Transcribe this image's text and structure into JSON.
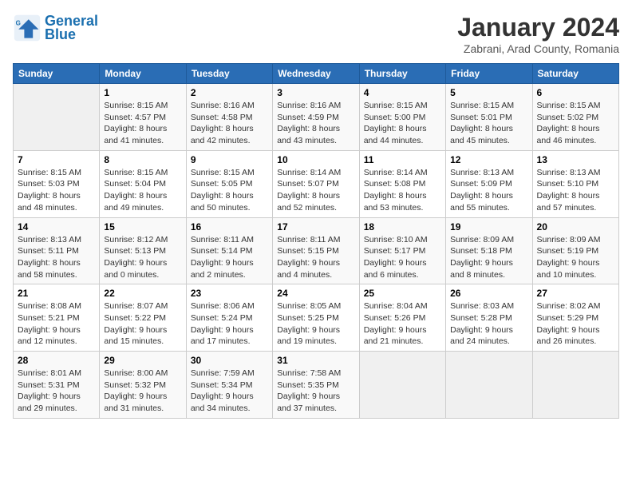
{
  "header": {
    "logo_line1": "General",
    "logo_line2": "Blue",
    "title": "January 2024",
    "subtitle": "Zabrani, Arad County, Romania"
  },
  "columns": [
    "Sunday",
    "Monday",
    "Tuesday",
    "Wednesday",
    "Thursday",
    "Friday",
    "Saturday"
  ],
  "weeks": [
    [
      {
        "day": "",
        "empty": true
      },
      {
        "day": "1",
        "sunrise": "8:15 AM",
        "sunset": "4:57 PM",
        "daylight": "8 hours and 41 minutes."
      },
      {
        "day": "2",
        "sunrise": "8:16 AM",
        "sunset": "4:58 PM",
        "daylight": "8 hours and 42 minutes."
      },
      {
        "day": "3",
        "sunrise": "8:16 AM",
        "sunset": "4:59 PM",
        "daylight": "8 hours and 43 minutes."
      },
      {
        "day": "4",
        "sunrise": "8:15 AM",
        "sunset": "5:00 PM",
        "daylight": "8 hours and 44 minutes."
      },
      {
        "day": "5",
        "sunrise": "8:15 AM",
        "sunset": "5:01 PM",
        "daylight": "8 hours and 45 minutes."
      },
      {
        "day": "6",
        "sunrise": "8:15 AM",
        "sunset": "5:02 PM",
        "daylight": "8 hours and 46 minutes."
      }
    ],
    [
      {
        "day": "7",
        "sunrise": "8:15 AM",
        "sunset": "5:03 PM",
        "daylight": "8 hours and 48 minutes."
      },
      {
        "day": "8",
        "sunrise": "8:15 AM",
        "sunset": "5:04 PM",
        "daylight": "8 hours and 49 minutes."
      },
      {
        "day": "9",
        "sunrise": "8:15 AM",
        "sunset": "5:05 PM",
        "daylight": "8 hours and 50 minutes."
      },
      {
        "day": "10",
        "sunrise": "8:14 AM",
        "sunset": "5:07 PM",
        "daylight": "8 hours and 52 minutes."
      },
      {
        "day": "11",
        "sunrise": "8:14 AM",
        "sunset": "5:08 PM",
        "daylight": "8 hours and 53 minutes."
      },
      {
        "day": "12",
        "sunrise": "8:13 AM",
        "sunset": "5:09 PM",
        "daylight": "8 hours and 55 minutes."
      },
      {
        "day": "13",
        "sunrise": "8:13 AM",
        "sunset": "5:10 PM",
        "daylight": "8 hours and 57 minutes."
      }
    ],
    [
      {
        "day": "14",
        "sunrise": "8:13 AM",
        "sunset": "5:11 PM",
        "daylight": "8 hours and 58 minutes."
      },
      {
        "day": "15",
        "sunrise": "8:12 AM",
        "sunset": "5:13 PM",
        "daylight": "9 hours and 0 minutes."
      },
      {
        "day": "16",
        "sunrise": "8:11 AM",
        "sunset": "5:14 PM",
        "daylight": "9 hours and 2 minutes."
      },
      {
        "day": "17",
        "sunrise": "8:11 AM",
        "sunset": "5:15 PM",
        "daylight": "9 hours and 4 minutes."
      },
      {
        "day": "18",
        "sunrise": "8:10 AM",
        "sunset": "5:17 PM",
        "daylight": "9 hours and 6 minutes."
      },
      {
        "day": "19",
        "sunrise": "8:09 AM",
        "sunset": "5:18 PM",
        "daylight": "9 hours and 8 minutes."
      },
      {
        "day": "20",
        "sunrise": "8:09 AM",
        "sunset": "5:19 PM",
        "daylight": "9 hours and 10 minutes."
      }
    ],
    [
      {
        "day": "21",
        "sunrise": "8:08 AM",
        "sunset": "5:21 PM",
        "daylight": "9 hours and 12 minutes."
      },
      {
        "day": "22",
        "sunrise": "8:07 AM",
        "sunset": "5:22 PM",
        "daylight": "9 hours and 15 minutes."
      },
      {
        "day": "23",
        "sunrise": "8:06 AM",
        "sunset": "5:24 PM",
        "daylight": "9 hours and 17 minutes."
      },
      {
        "day": "24",
        "sunrise": "8:05 AM",
        "sunset": "5:25 PM",
        "daylight": "9 hours and 19 minutes."
      },
      {
        "day": "25",
        "sunrise": "8:04 AM",
        "sunset": "5:26 PM",
        "daylight": "9 hours and 21 minutes."
      },
      {
        "day": "26",
        "sunrise": "8:03 AM",
        "sunset": "5:28 PM",
        "daylight": "9 hours and 24 minutes."
      },
      {
        "day": "27",
        "sunrise": "8:02 AM",
        "sunset": "5:29 PM",
        "daylight": "9 hours and 26 minutes."
      }
    ],
    [
      {
        "day": "28",
        "sunrise": "8:01 AM",
        "sunset": "5:31 PM",
        "daylight": "9 hours and 29 minutes."
      },
      {
        "day": "29",
        "sunrise": "8:00 AM",
        "sunset": "5:32 PM",
        "daylight": "9 hours and 31 minutes."
      },
      {
        "day": "30",
        "sunrise": "7:59 AM",
        "sunset": "5:34 PM",
        "daylight": "9 hours and 34 minutes."
      },
      {
        "day": "31",
        "sunrise": "7:58 AM",
        "sunset": "5:35 PM",
        "daylight": "9 hours and 37 minutes."
      },
      {
        "day": "",
        "empty": true
      },
      {
        "day": "",
        "empty": true
      },
      {
        "day": "",
        "empty": true
      }
    ]
  ]
}
